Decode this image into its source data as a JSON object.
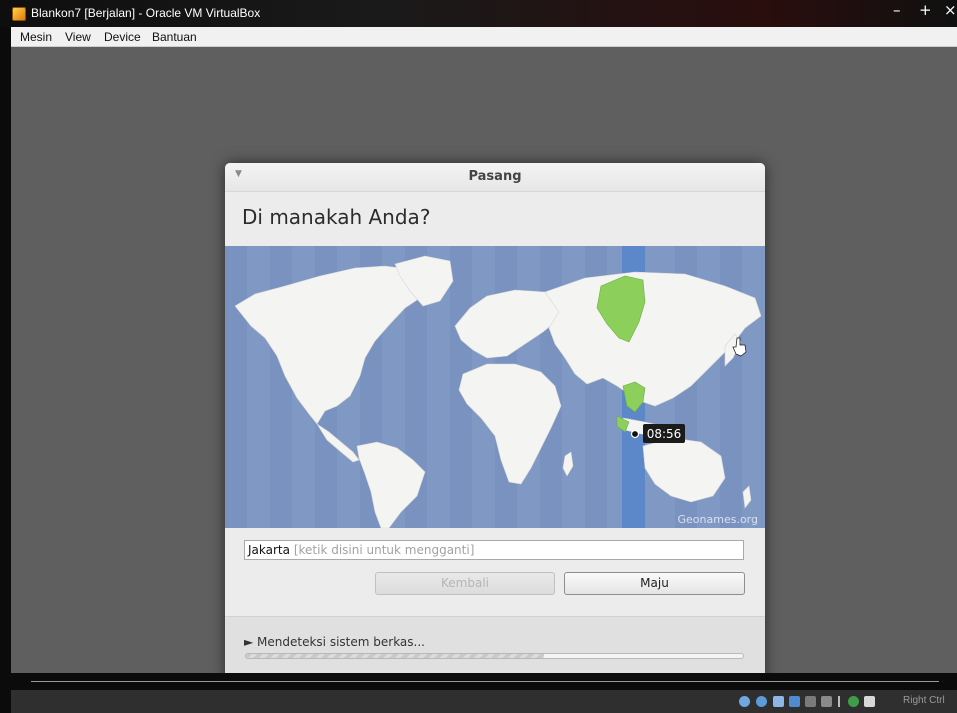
{
  "window": {
    "title": "Blankon7 [Berjalan] - Oracle VM VirtualBox",
    "controls": {
      "minimize": "–",
      "maximize": "+",
      "close": "×"
    }
  },
  "menubar": {
    "items": [
      "Mesin",
      "View",
      "Device",
      "Bantuan"
    ]
  },
  "installer": {
    "dialog_title": "Pasang",
    "heading": "Di manakah Anda?",
    "map": {
      "time_label": "08:56",
      "attribution": "Geonames.org",
      "colors": {
        "ocean": "#8098c4",
        "land": "#f4f4f2",
        "zone_highlight": "#5c87c8",
        "selected_land": "#8ccf5a"
      }
    },
    "city": {
      "value": "Jakarta",
      "hint": "[ketik disini untuk mengganti]"
    },
    "buttons": {
      "back": "Kembali",
      "next": "Maju"
    },
    "status": {
      "label": "Mendeteksi sistem berkas...",
      "progress": 0.6
    }
  },
  "statusbar": {
    "host_key": "Right Ctrl"
  }
}
